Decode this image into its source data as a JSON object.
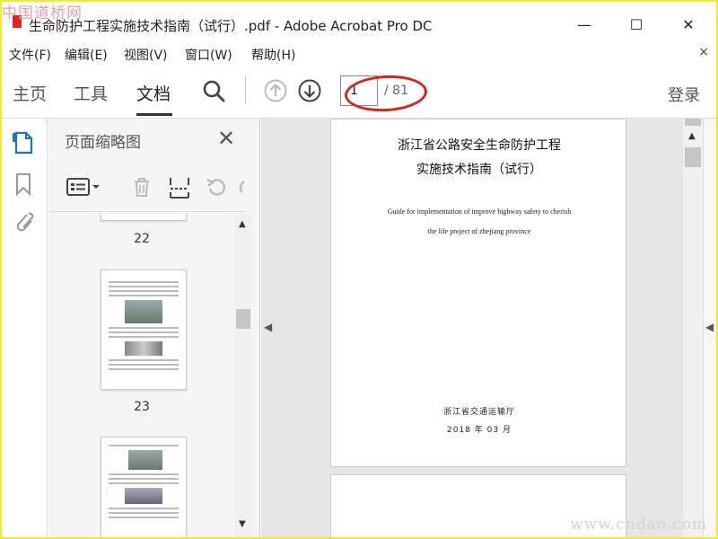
{
  "window": {
    "title": "生命防护工程实施技术指南（试行）.pdf - Adobe Acrobat Pro DC",
    "minimize": "—",
    "maximize": "☐",
    "close": "✕"
  },
  "watermark": {
    "top": "中国道桥网",
    "bottom": "www.cndao.com"
  },
  "menu": {
    "items": [
      "文件(F)",
      "编辑(E)",
      "视图(V)",
      "窗口(W)",
      "帮助(H)"
    ],
    "close": "×"
  },
  "toolbar": {
    "tabs": [
      "主页",
      "工具",
      "文档"
    ],
    "active_tab": "文档",
    "page_current": "1",
    "page_total": "/ 81",
    "login": "登录"
  },
  "thumbnails": {
    "title": "页面缩略图",
    "close": "✕",
    "pages": [
      "22",
      "23"
    ]
  },
  "document": {
    "title_line1": "浙江省公路安全生命防护工程",
    "title_line2": "实施技术指南（试行）",
    "subtitle_line1": "Guide for implementation of improve highway safety to cherish",
    "subtitle_line2": "the life project of zhejiang province",
    "publisher": "浙江省交通运输厅",
    "date": "2018 年 03 月"
  },
  "colors": {
    "accent": "#1a73c8",
    "annotation": "#d8231d",
    "frame": "#f2ea2b"
  }
}
